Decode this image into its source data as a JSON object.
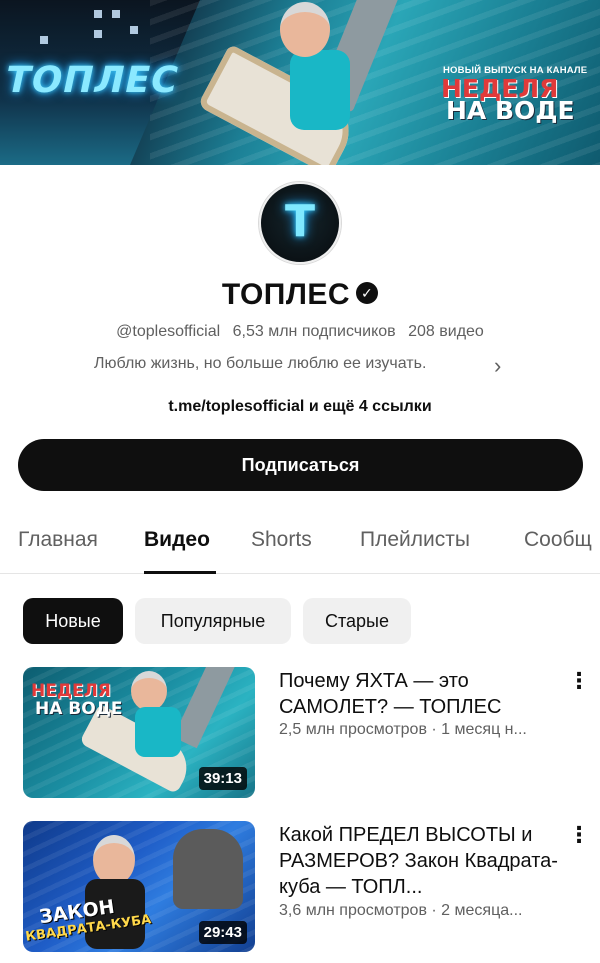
{
  "banner": {
    "logo_text": "ТОПЛЕС",
    "promo_small": "НОВЫЙ ВЫПУСК НА КАНАЛЕ",
    "promo_line1": "НЕДЕЛЯ",
    "promo_line2": "НА ВОДЕ"
  },
  "channel": {
    "avatar_letter": "T",
    "name": "ТОПЛЕС",
    "verified_icon": "✓",
    "handle": "@toplesofficial",
    "subscribers": "6,53 млн подписчиков",
    "video_count": "208 видео",
    "description": "Люблю жизнь, но больше люблю ее изучать.",
    "links": "t.me/toplesofficial и ещё 4 ссылки",
    "subscribe_label": "Подписаться"
  },
  "tabs": [
    {
      "label": "Главная"
    },
    {
      "label": "Видео"
    },
    {
      "label": "Shorts"
    },
    {
      "label": "Плейлисты"
    },
    {
      "label": "Сообщ"
    }
  ],
  "chips": [
    {
      "label": "Новые"
    },
    {
      "label": "Популярные"
    },
    {
      "label": "Старые"
    }
  ],
  "videos": [
    {
      "thumb_line1": "НЕДЕЛЯ",
      "thumb_line2": "НА ВОДЕ",
      "duration": "39:13",
      "title": "Почему ЯХТА — это САМОЛЕТ? — ТОПЛЕС",
      "meta": "2,5 млн просмотров · 1 месяц н..."
    },
    {
      "thumb_line1": "ЗАКОН",
      "thumb_line2": "КВАДРАТА-КУБА",
      "duration": "29:43",
      "title": "Какой ПРЕДЕЛ ВЫСОТЫ и РАЗМЕРОВ? Закон Квадрата-куба — ТОПЛ...",
      "meta": "3,6 млн просмотров · 2 месяца..."
    }
  ],
  "colors": {
    "text_primary": "#0f0f0f",
    "text_secondary": "#606060",
    "chip_bg": "#f0f0f0",
    "button_bg": "#0f0f0f"
  }
}
